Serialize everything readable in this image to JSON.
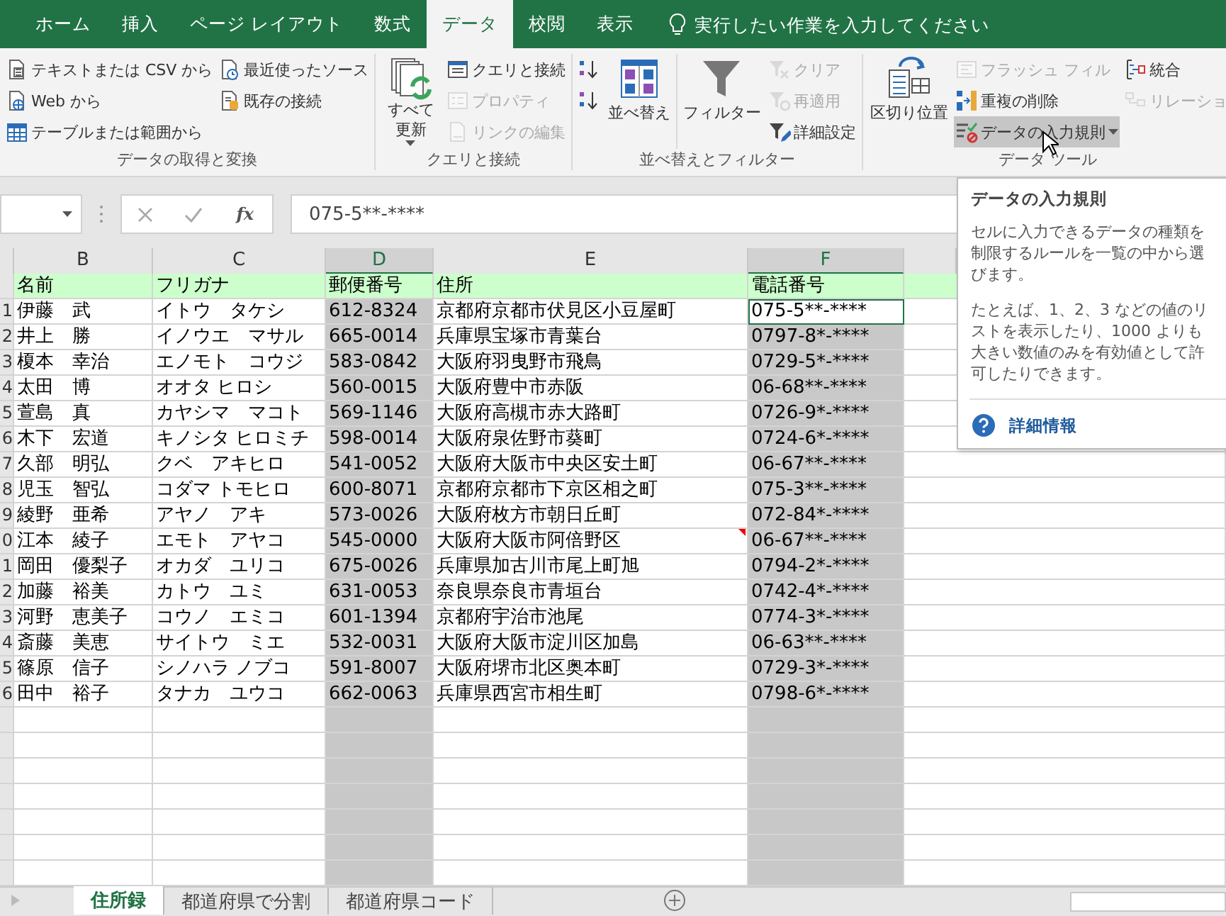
{
  "ribbon_tabs": [
    {
      "label": "ホーム",
      "selected": false
    },
    {
      "label": "挿入",
      "selected": false
    },
    {
      "label": "ページ レイアウト",
      "selected": false
    },
    {
      "label": "数式",
      "selected": false
    },
    {
      "label": "データ",
      "selected": true
    },
    {
      "label": "校閲",
      "selected": false
    },
    {
      "label": "表示",
      "selected": false
    }
  ],
  "tell_me": {
    "placeholder": "実行したい作業を入力してください"
  },
  "ribbon_groups": [
    {
      "label": "データの取得と変換",
      "columns": [
        {
          "kind": "stack",
          "commands": [
            {
              "label": "テキストまたは CSV から",
              "disabled": false,
              "dropdown": false,
              "hovered": false
            },
            {
              "label": "Web から",
              "disabled": false,
              "dropdown": false,
              "hovered": false
            },
            {
              "label": "テーブルまたは範囲から",
              "disabled": false,
              "dropdown": false,
              "hovered": false
            }
          ]
        },
        {
          "kind": "stack",
          "commands": [
            {
              "label": "最近使ったソース",
              "disabled": false,
              "dropdown": false,
              "hovered": false
            },
            {
              "label": "既存の接続",
              "disabled": false,
              "dropdown": false,
              "hovered": false
            }
          ]
        }
      ]
    },
    {
      "label": "クエリと接続",
      "columns": [
        {
          "kind": "large",
          "commands": [
            {
              "label": "すべて更新",
              "disabled": false,
              "dropdown": true,
              "hovered": false
            }
          ]
        },
        {
          "kind": "stack",
          "commands": [
            {
              "label": "クエリと接続",
              "disabled": false,
              "dropdown": false,
              "hovered": false
            },
            {
              "label": "プロパティ",
              "disabled": true,
              "dropdown": false,
              "hovered": false
            },
            {
              "label": "リンクの編集",
              "disabled": true,
              "dropdown": false,
              "hovered": false
            }
          ]
        }
      ]
    },
    {
      "label": "並べ替えとフィルター",
      "columns": [
        {
          "kind": "stack",
          "commands": [
            {
              "disabled": false,
              "dropdown": false,
              "hovered": false
            },
            {
              "disabled": false,
              "dropdown": false,
              "hovered": false
            }
          ]
        },
        {
          "kind": "large",
          "commands": [
            {
              "label": "並べ替え",
              "disabled": false,
              "dropdown": false,
              "hovered": false
            }
          ]
        },
        {
          "kind": "large",
          "commands": [
            {
              "label": "フィルター",
              "disabled": false,
              "dropdown": false,
              "hovered": false
            }
          ]
        },
        {
          "kind": "stack",
          "commands": [
            {
              "label": "クリア",
              "disabled": true,
              "dropdown": false,
              "hovered": false
            },
            {
              "label": "再適用",
              "disabled": true,
              "dropdown": false,
              "hovered": false
            },
            {
              "label": "詳細設定",
              "disabled": false,
              "dropdown": false,
              "hovered": false
            }
          ]
        }
      ]
    },
    {
      "label": "データ ツール",
      "columns": [
        {
          "kind": "large",
          "commands": [
            {
              "label": "区切り位置",
              "disabled": false,
              "dropdown": false,
              "hovered": false
            }
          ]
        },
        {
          "kind": "stack",
          "commands": [
            {
              "label": "フラッシュ フィル",
              "disabled": true,
              "dropdown": false,
              "hovered": false
            },
            {
              "label": "重複の削除",
              "disabled": false,
              "dropdown": false,
              "hovered": false
            },
            {
              "label": "データの入力規則",
              "disabled": false,
              "dropdown": true,
              "hovered": true
            }
          ]
        },
        {
          "kind": "stack",
          "commands": [
            {
              "label": "統合",
              "disabled": false,
              "dropdown": false,
              "hovered": false
            },
            {
              "label": "リレーショ",
              "disabled": true,
              "dropdown": false,
              "hovered": false
            }
          ]
        }
      ]
    }
  ],
  "formula_bar": {
    "insert_function": "fx",
    "value": "075-5**-****"
  },
  "sheet": {
    "columns": [
      {
        "label": "B",
        "selected": false,
        "shaded": false
      },
      {
        "label": "C",
        "selected": false,
        "shaded": false
      },
      {
        "label": "D",
        "selected": true,
        "shaded": true
      },
      {
        "label": "E",
        "selected": false,
        "shaded": false
      },
      {
        "label": "F",
        "selected": true,
        "shaded": true
      }
    ],
    "header_cells": [
      "名前",
      "フリガナ",
      "郵便番号",
      "住所",
      "電話番号"
    ],
    "rows": [
      {
        "number": "1",
        "cells": [
          "伊藤　武",
          "イトウ　タケシ",
          "612-8324",
          "京都府京都市伏見区小豆屋町",
          "075-5**-****"
        ],
        "active": true,
        "comment": false
      },
      {
        "number": "2",
        "cells": [
          "井上　勝",
          "イノウエ　マサル",
          "665-0014",
          "兵庫県宝塚市青葉台",
          "0797-8*-****"
        ],
        "active": false,
        "comment": false
      },
      {
        "number": "3",
        "cells": [
          "榎本　幸治",
          "エノモト　コウジ",
          "583-0842",
          "大阪府羽曳野市飛鳥",
          "0729-5*-****"
        ],
        "active": false,
        "comment": false
      },
      {
        "number": "4",
        "cells": [
          "太田　博",
          "オオタ ヒロシ",
          "560-0015",
          "大阪府豊中市赤阪",
          "06-68**-****"
        ],
        "active": false,
        "comment": false
      },
      {
        "number": "5",
        "cells": [
          "萱島　真",
          "カヤシマ　マコト",
          "569-1146",
          "大阪府高槻市赤大路町",
          "0726-9*-****"
        ],
        "active": false,
        "comment": false
      },
      {
        "number": "6",
        "cells": [
          "木下　宏道",
          "キノシタ ヒロミチ",
          "598-0014",
          "大阪府泉佐野市葵町",
          "0724-6*-****"
        ],
        "active": false,
        "comment": false
      },
      {
        "number": "7",
        "cells": [
          "久部　明弘",
          "クベ　アキヒロ",
          "541-0052",
          "大阪府大阪市中央区安土町",
          "06-67**-****"
        ],
        "active": false,
        "comment": false
      },
      {
        "number": "8",
        "cells": [
          "児玉　智弘",
          "コダマ トモヒロ",
          "600-8071",
          "京都府京都市下京区相之町",
          "075-3**-****"
        ],
        "active": false,
        "comment": false
      },
      {
        "number": "9",
        "cells": [
          "綾野　亜希",
          "アヤノ　アキ",
          "573-0026",
          "大阪府枚方市朝日丘町",
          "072-84*-****"
        ],
        "active": false,
        "comment": false
      },
      {
        "number": "0",
        "cells": [
          "江本　綾子",
          "エモト　アヤコ",
          "545-0000",
          "大阪府大阪市阿倍野区",
          "06-67**-****"
        ],
        "active": false,
        "comment": true
      },
      {
        "number": "1",
        "cells": [
          "岡田　優梨子",
          "オカダ　ユリコ",
          "675-0026",
          "兵庫県加古川市尾上町旭",
          "0794-2*-****"
        ],
        "active": false,
        "comment": false
      },
      {
        "number": "2",
        "cells": [
          "加藤　裕美",
          "カトウ　ユミ",
          "631-0053",
          "奈良県奈良市青垣台",
          "0742-4*-****"
        ],
        "active": false,
        "comment": false
      },
      {
        "number": "3",
        "cells": [
          "河野　恵美子",
          "コウノ　エミコ",
          "601-1394",
          "京都府宇治市池尾",
          "0774-3*-****"
        ],
        "active": false,
        "comment": false
      },
      {
        "number": "4",
        "cells": [
          "斎藤　美恵",
          "サイトウ　ミエ",
          "532-0031",
          "大阪府大阪市淀川区加島",
          "06-63**-****"
        ],
        "active": false,
        "comment": false
      },
      {
        "number": "5",
        "cells": [
          "篠原　信子",
          "シノハラ ノブコ",
          "591-8007",
          "大阪府堺市北区奥本町",
          "0729-3*-****"
        ],
        "active": false,
        "comment": false
      },
      {
        "number": "6",
        "cells": [
          "田中　裕子",
          "タナカ　ユウコ",
          "662-0063",
          "兵庫県西宮市相生町",
          "0798-6*-****"
        ],
        "active": false,
        "comment": false
      }
    ]
  },
  "tooltip": {
    "title": "データの入力規則",
    "paragraphs": [
      "セルに入力できるデータの種類を制限するルールを一覧の中から選びます。",
      "たとえば、1、2、3 などの値のリストを表示したり、1000 よりも大きい数値のみを有効値として許可したりできます。"
    ],
    "link": "詳細情報"
  },
  "sheet_tabs": [
    {
      "label": "住所録",
      "selected": true
    },
    {
      "label": "都道府県で分割",
      "selected": false
    },
    {
      "label": "都道府県コード",
      "selected": false
    }
  ]
}
